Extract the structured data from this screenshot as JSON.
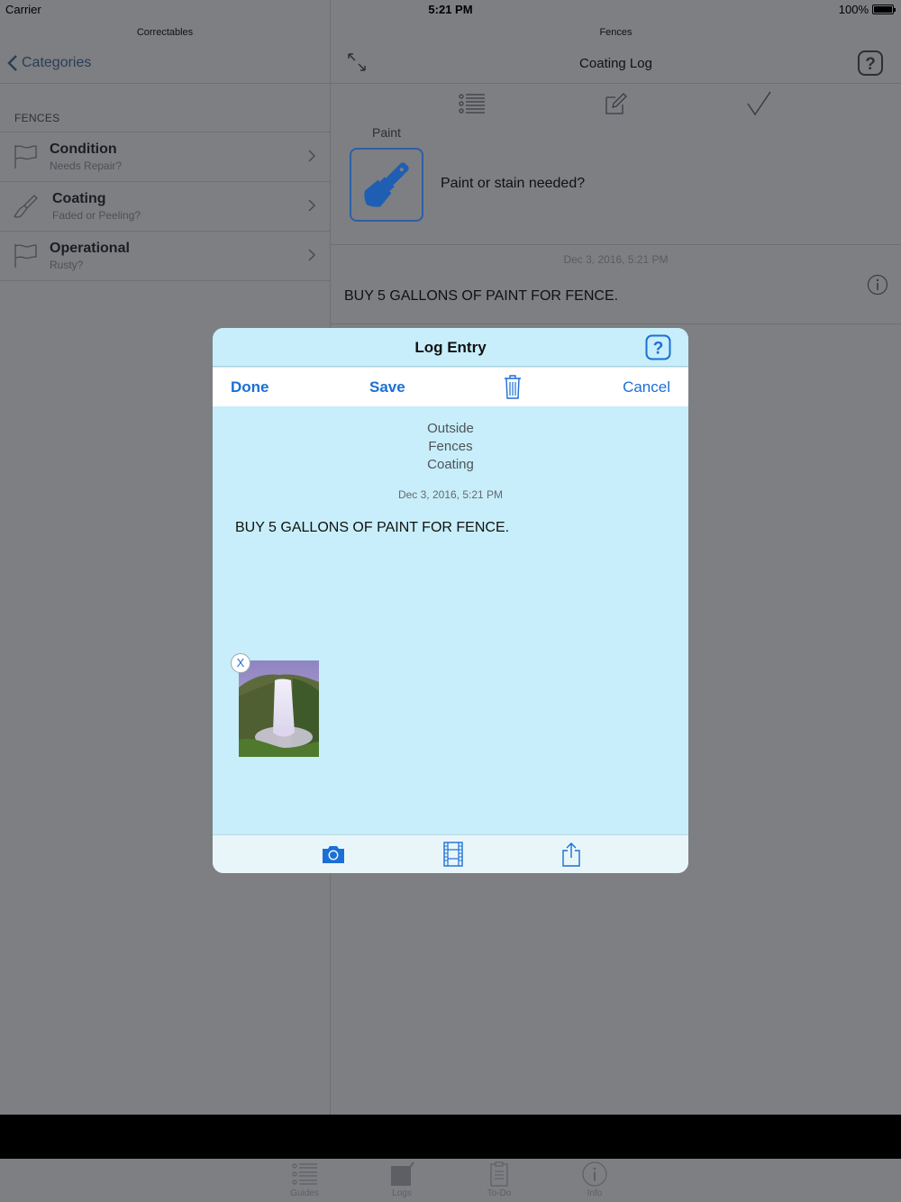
{
  "status_bar": {
    "carrier": "Carrier",
    "time": "5:21 PM",
    "battery": "100%"
  },
  "left_nav": {
    "mini_title": "Correctables",
    "back_label": "Categories"
  },
  "section": {
    "header": "FENCES"
  },
  "categories": [
    {
      "title": "Condition",
      "subtitle": "Needs Repair?",
      "icon": "flag-icon"
    },
    {
      "title": "Coating",
      "subtitle": "Faded or Peeling?",
      "icon": "paintbrush-icon"
    },
    {
      "title": "Operational",
      "subtitle": "Rusty?",
      "icon": "flag-icon"
    }
  ],
  "right_nav": {
    "mini_title": "Fences",
    "title": "Coating Log"
  },
  "right_pane": {
    "paint_label": "Paint",
    "question": "Paint or stain needed?",
    "entry_date": "Dec 3, 2016, 5:21 PM",
    "entry_text": "BUY 5 GALLONS OF PAINT FOR FENCE."
  },
  "modal": {
    "title": "Log Entry",
    "done": "Done",
    "save": "Save",
    "cancel": "Cancel",
    "path": [
      "Outside",
      "Fences",
      "Coating"
    ],
    "date": "Dec 3, 2016, 5:21 PM",
    "text": "BUY 5 GALLONS OF PAINT FOR FENCE.",
    "remove_label": "X"
  },
  "tabs": [
    {
      "label": "Guides",
      "icon": "list-icon"
    },
    {
      "label": "Logs",
      "icon": "check-square-icon"
    },
    {
      "label": "To-Do",
      "icon": "clipboard-icon"
    },
    {
      "label": "Info",
      "icon": "info-icon"
    }
  ],
  "colors": {
    "accent": "#1b6fd6",
    "modal_bg": "#c7eefa",
    "dim_bg": "#7e7f83"
  }
}
